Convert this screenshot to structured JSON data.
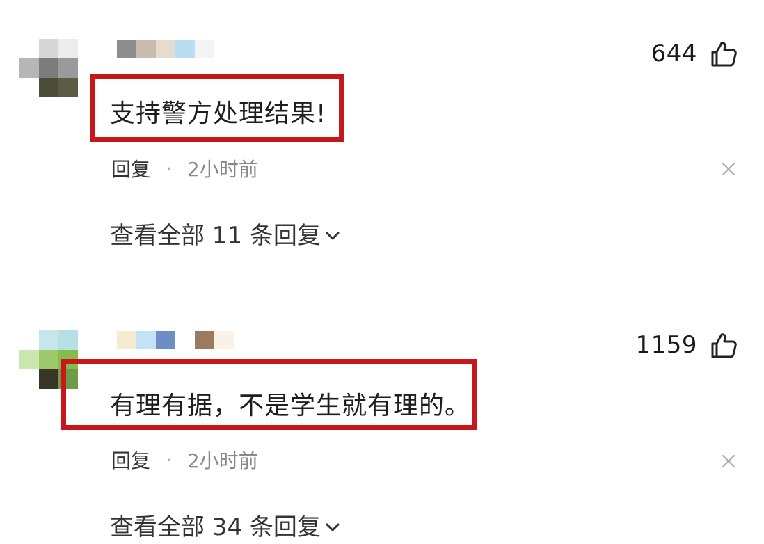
{
  "comments": [
    {
      "likes": "644",
      "text": "支持警方处理结果!",
      "reply_label": "回复",
      "separator": "·",
      "time": "2小时前",
      "view_replies": "查看全部 11 条回复"
    },
    {
      "likes": "1159",
      "text": "有理有据，不是学生就有理的。",
      "reply_label": "回复",
      "separator": "·",
      "time": "2小时前",
      "view_replies": "查看全部 34 条回复"
    }
  ],
  "icons": {
    "like": "thumbs-up-icon",
    "close": "close-icon",
    "expand": "chevron-down-icon"
  },
  "colors": {
    "highlight_border": "#c8161d",
    "meta_text": "#888888"
  }
}
